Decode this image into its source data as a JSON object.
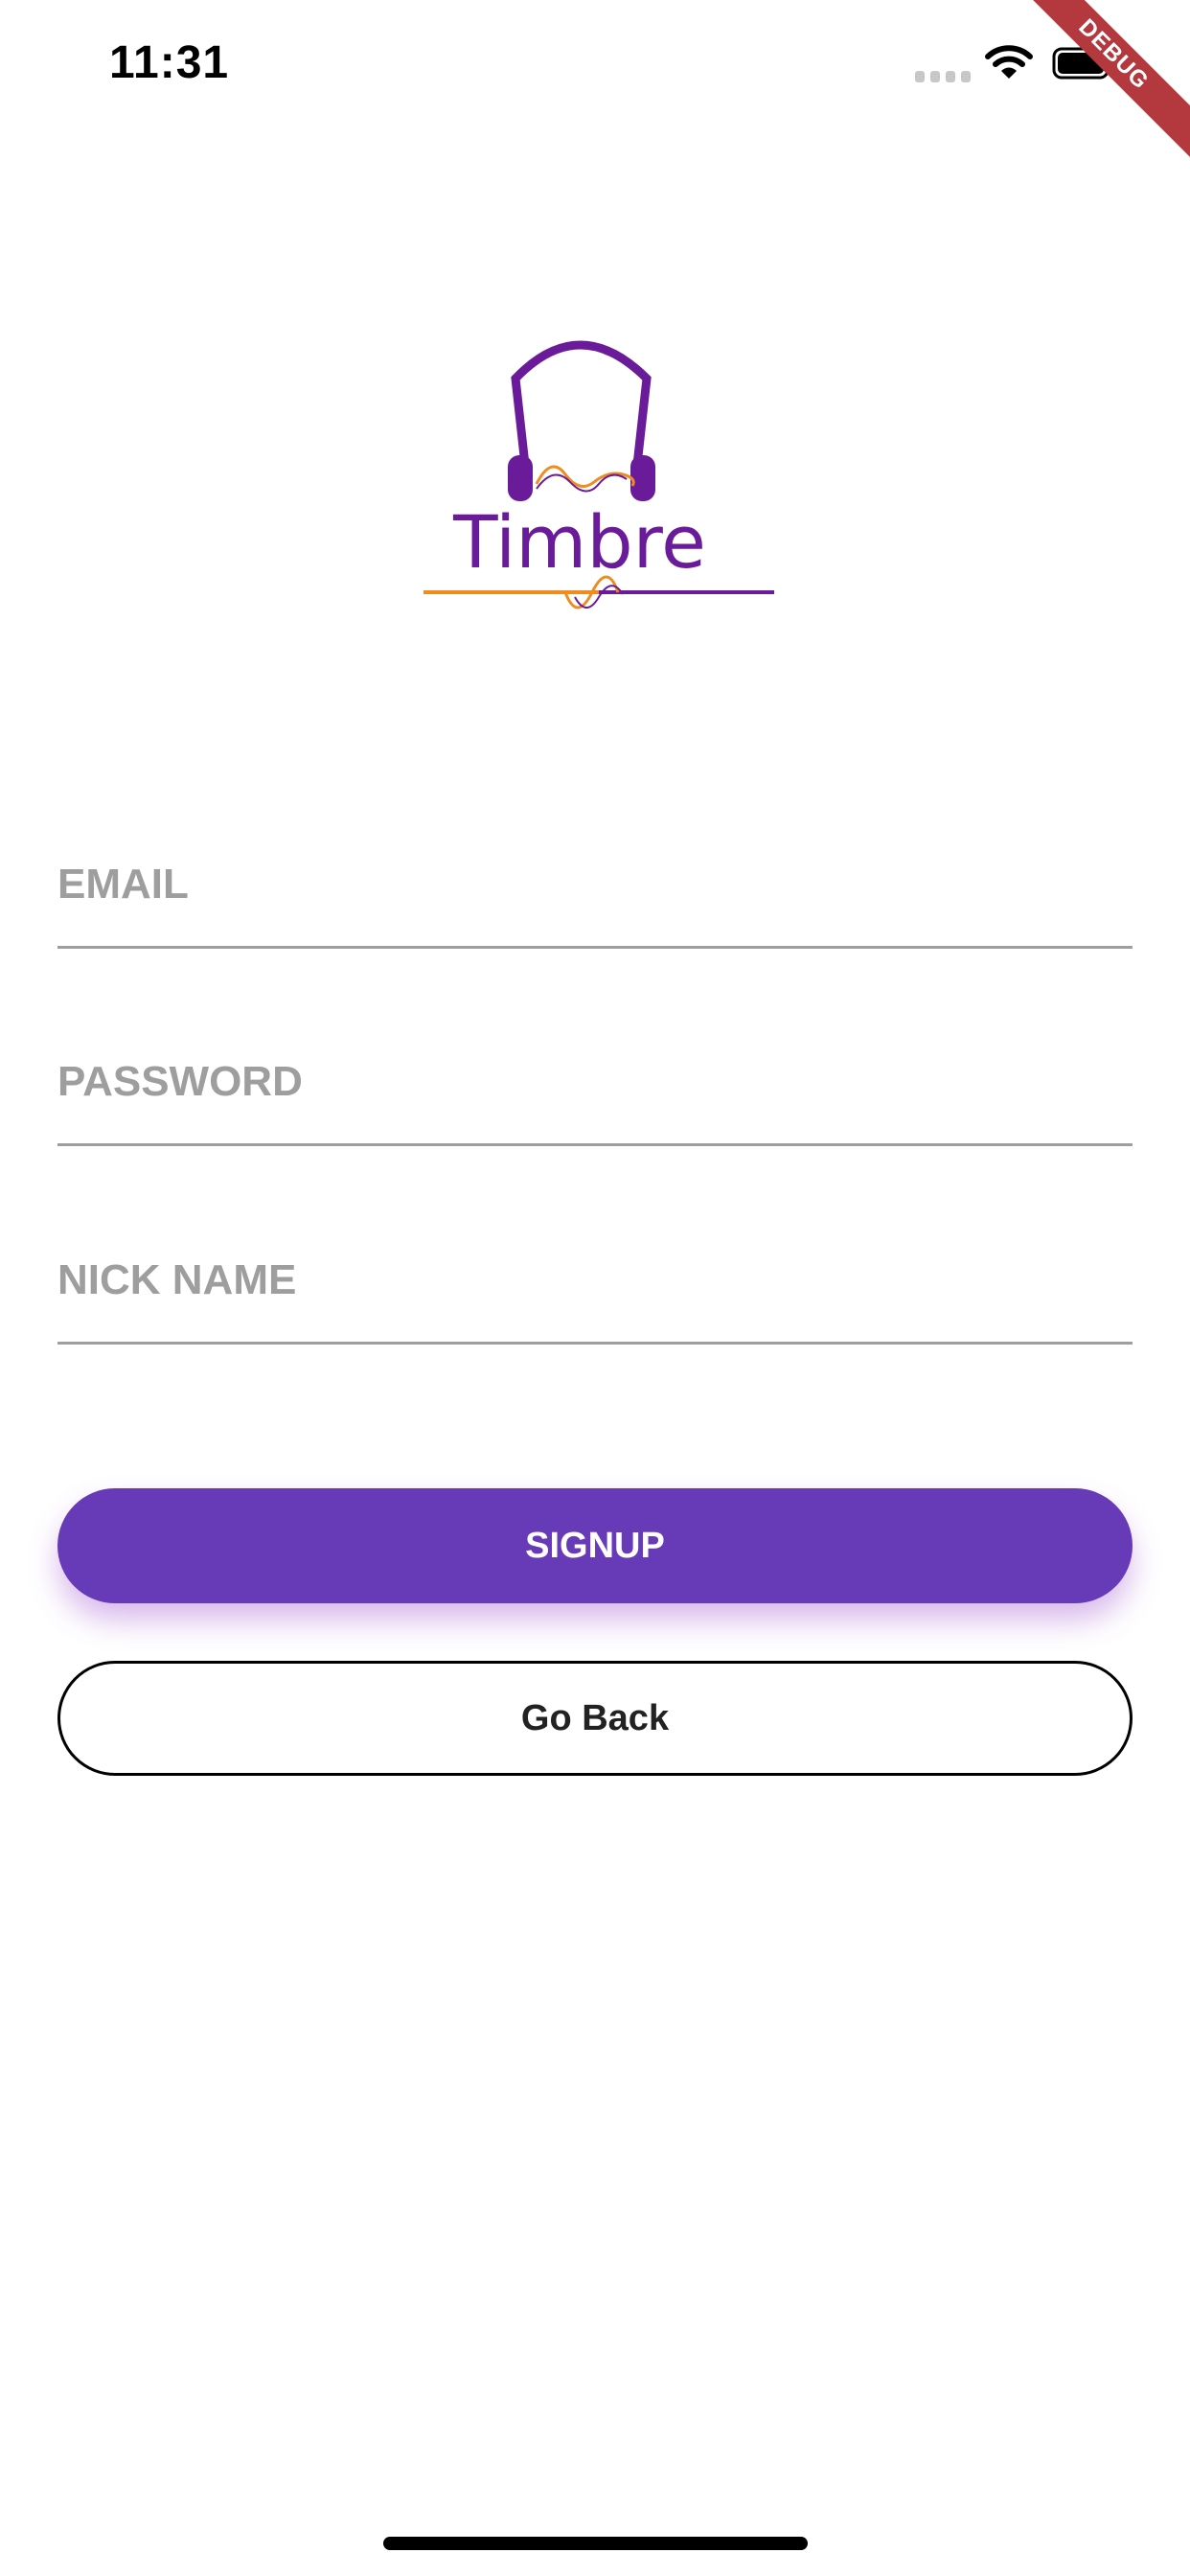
{
  "status_bar": {
    "time": "11:31"
  },
  "debug_banner": "DEBUG",
  "logo": {
    "text": "Timbre"
  },
  "form": {
    "email_placeholder": "EMAIL",
    "password_placeholder": "PASSWORD",
    "nickname_placeholder": "NICK NAME"
  },
  "buttons": {
    "signup": "SIGNUP",
    "go_back": "Go Back"
  },
  "colors": {
    "primary": "#673ab7",
    "logo_purple": "#6a1b9a",
    "logo_orange": "#f08c1e",
    "debug_red": "#b3393f",
    "placeholder_gray": "#9e9e9e"
  },
  "icons": [
    "signal-icon",
    "wifi-icon",
    "battery-icon",
    "headphones-icon"
  ]
}
